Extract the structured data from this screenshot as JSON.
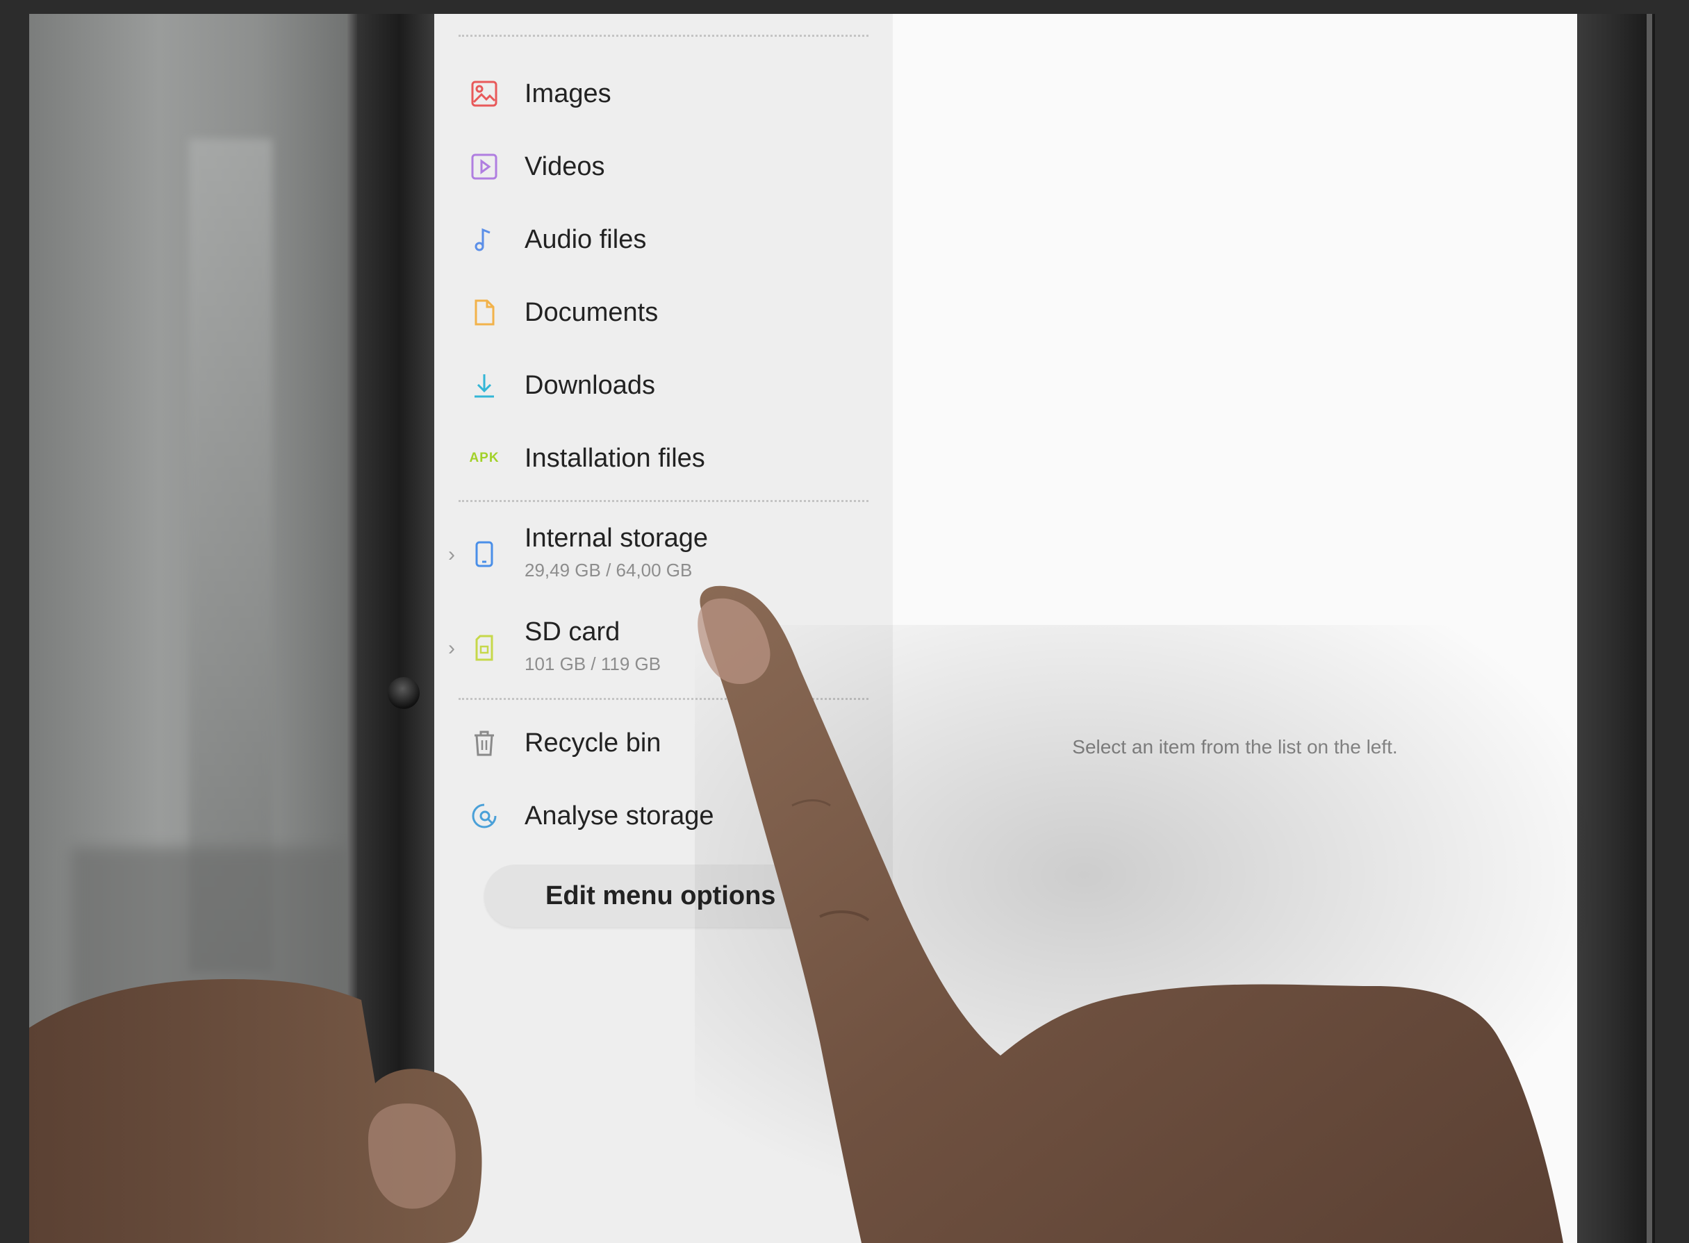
{
  "sidebar": {
    "items": [
      {
        "label": "Images",
        "icon": "image-icon",
        "color": "#e8595a"
      },
      {
        "label": "Videos",
        "icon": "video-icon",
        "color": "#b07ee0"
      },
      {
        "label": "Audio files",
        "icon": "music-note-icon",
        "color": "#5b8fe8"
      },
      {
        "label": "Documents",
        "icon": "document-icon",
        "color": "#f2b24a"
      },
      {
        "label": "Downloads",
        "icon": "download-icon",
        "color": "#33b6d6"
      },
      {
        "label": "Installation files",
        "icon": "apk-icon",
        "icon_text": "APK",
        "color": "#a2d12a"
      }
    ],
    "storage": [
      {
        "label": "Internal storage",
        "usage": "29,49 GB / 64,00 GB",
        "icon": "phone-icon",
        "color": "#4a8fe8"
      },
      {
        "label": "SD card",
        "usage": "101 GB / 119 GB",
        "icon": "sd-card-icon",
        "color": "#c6d84a"
      }
    ],
    "tools": [
      {
        "label": "Recycle bin",
        "icon": "trash-icon",
        "color": "#8a8a8a"
      },
      {
        "label": "Analyse storage",
        "icon": "analyse-storage-icon",
        "color": "#4aa0d8"
      }
    ],
    "edit_button_label": "Edit menu options"
  },
  "main": {
    "empty_hint": "Select an item from the list on the left."
  }
}
